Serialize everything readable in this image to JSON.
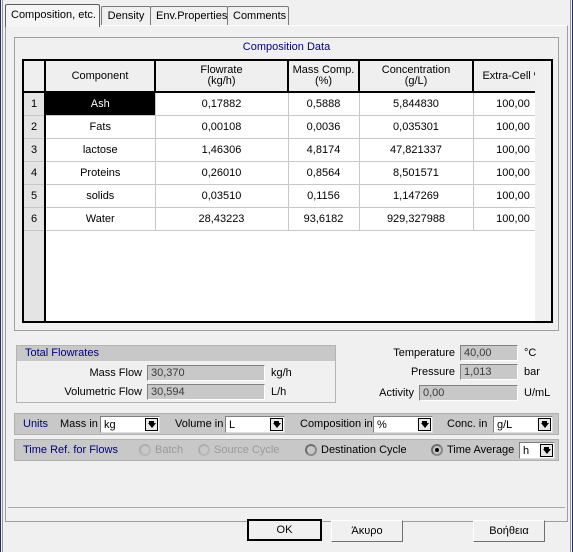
{
  "window": {
    "tabs": [
      {
        "label": "Composition, etc.",
        "active": true
      },
      {
        "label": "Density",
        "active": false
      },
      {
        "label": "Env.Properties",
        "active": false
      },
      {
        "label": "Comments",
        "active": false
      }
    ]
  },
  "composition": {
    "group_title": "Composition Data",
    "columns": [
      {
        "line1": "",
        "line2": ""
      },
      {
        "line1": "Component",
        "line2": ""
      },
      {
        "line1": "Flowrate",
        "line2": "(kg/h)"
      },
      {
        "line1": "Mass Comp.",
        "line2": "(%)"
      },
      {
        "line1": "Concentration",
        "line2": "(g/L)"
      },
      {
        "line1": "Extra-Cell %",
        "line2": ""
      },
      {
        "line1": "",
        "line2": ""
      }
    ],
    "rows": [
      {
        "num": "1",
        "component": "Ash",
        "flowrate": "0,17882",
        "mass_comp": "0,5888",
        "concentration": "5,844830",
        "extra_cell": "100,00",
        "selected": true
      },
      {
        "num": "2",
        "component": "Fats",
        "flowrate": "0,00108",
        "mass_comp": "0,0036",
        "concentration": "0,035301",
        "extra_cell": "100,00",
        "selected": false
      },
      {
        "num": "3",
        "component": "lactose",
        "flowrate": "1,46306",
        "mass_comp": "4,8174",
        "concentration": "47,821337",
        "extra_cell": "100,00",
        "selected": false
      },
      {
        "num": "4",
        "component": "Proteins",
        "flowrate": "0,26010",
        "mass_comp": "0,8564",
        "concentration": "8,501571",
        "extra_cell": "100,00",
        "selected": false
      },
      {
        "num": "5",
        "component": "solids",
        "flowrate": "0,03510",
        "mass_comp": "0,1156",
        "concentration": "1,147269",
        "extra_cell": "100,00",
        "selected": false
      },
      {
        "num": "6",
        "component": "Water",
        "flowrate": "28,43223",
        "mass_comp": "93,6182",
        "concentration": "929,327988",
        "extra_cell": "100,00",
        "selected": false
      }
    ]
  },
  "total_flowrates": {
    "caption": "Total Flowrates",
    "mass_flow_label": "Mass Flow",
    "mass_flow_value": "30,370",
    "mass_flow_unit": "kg/h",
    "volumetric_flow_label": "Volumetric Flow",
    "volumetric_flow_value": "30,594",
    "volumetric_flow_unit": "L/h"
  },
  "properties": {
    "temperature_label": "Temperature",
    "temperature_value": "40,00",
    "temperature_unit": "°C",
    "pressure_label": "Pressure",
    "pressure_value": "1,013",
    "pressure_unit": "bar",
    "activity_label": "Activity",
    "activity_value": "0,00",
    "activity_unit": "U/mL"
  },
  "units_bar": {
    "title": "Units",
    "mass_label": "Mass in",
    "mass_value": "kg",
    "volume_label": "Volume in",
    "volume_value": "L",
    "composition_label": "Composition in",
    "composition_value": "%",
    "conc_label": "Conc. in",
    "conc_value": "g/L"
  },
  "time_ref_bar": {
    "title": "Time Ref. for Flows",
    "options": [
      {
        "label": "Batch",
        "selected": false,
        "disabled": true
      },
      {
        "label": "Source Cycle",
        "selected": false,
        "disabled": true
      },
      {
        "label": "Destination Cycle",
        "selected": false,
        "disabled": false
      },
      {
        "label": "Time Average",
        "selected": true,
        "disabled": false
      }
    ],
    "time_unit_value": "h"
  },
  "buttons": {
    "ok": "OK",
    "cancel": "Άκυρο",
    "help": "Βοήθεια"
  },
  "colors": {
    "accent_blue": "#00007c",
    "panel_gray": "#f0f0f0",
    "caption_gray": "#c8c8c8",
    "selection_black": "#000000"
  }
}
